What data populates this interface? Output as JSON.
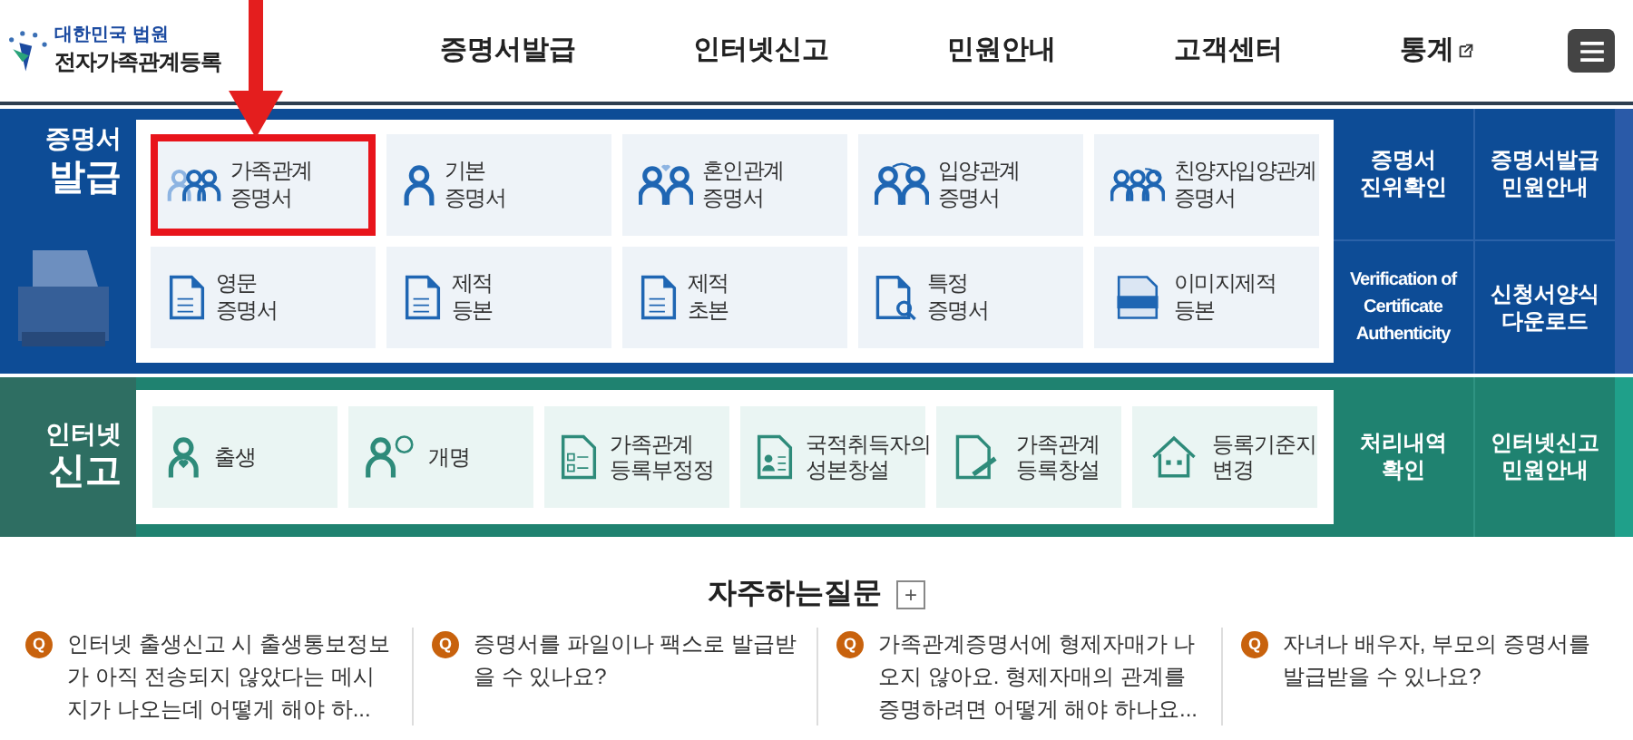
{
  "header": {
    "org": "대한민국 법원",
    "site_title": "전자가족관계등록",
    "nav": [
      "증명서발급",
      "인터넷신고",
      "민원안내",
      "고객센터",
      "통계"
    ]
  },
  "issue": {
    "label_top": "증명서",
    "label_main": "발급",
    "tiles": [
      {
        "label": "가족관계\n증명서",
        "highlighted": true
      },
      {
        "label": "기본\n증명서",
        "highlighted": false
      },
      {
        "label": "혼인관계\n증명서",
        "highlighted": false
      },
      {
        "label": "입양관계\n증명서",
        "highlighted": false
      },
      {
        "label": "친양자입양관계\n증명서",
        "highlighted": false
      },
      {
        "label": "영문\n증명서",
        "highlighted": false
      },
      {
        "label": "제적\n등본",
        "highlighted": false
      },
      {
        "label": "제적\n초본",
        "highlighted": false
      },
      {
        "label": "특정\n증명서",
        "highlighted": false
      },
      {
        "label": "이미지제적\n등본",
        "highlighted": false
      }
    ],
    "links": [
      "증명서\n진위확인",
      "증명서발급\n민원안내",
      "Verification of\nCertificate\nAuthenticity",
      "신청서양식\n다운로드"
    ]
  },
  "report": {
    "label_top": "인터넷",
    "label_main": "신고",
    "tiles": [
      "출생",
      "개명",
      "가족관계\n등록부정정",
      "국적취득자의\n성본창설",
      "가족관계\n등록창설",
      "등록기준지\n변경"
    ],
    "links": [
      "처리내역\n확인",
      "인터넷신고\n민원안내"
    ]
  },
  "faq": {
    "title": "자주하는질문",
    "more": "+",
    "items": [
      {
        "badge": "Q",
        "text": "인터넷 출생신고 시 출생통보정보가 아직 전송되지 않았다는 메시지가 나오는데 어떻게 해야 하..."
      },
      {
        "badge": "Q",
        "text": "증명서를 파일이나 팩스로 발급받을 수 있나요?"
      },
      {
        "badge": "Q",
        "text": "가족관계증명서에 형제자매가 나오지 않아요. 형제자매의 관계를 증명하려면 어떻게 해야 하나요..."
      },
      {
        "badge": "Q",
        "text": "자녀나 배우자, 부모의 증명서를 발급받을 수 있나요?"
      }
    ]
  }
}
